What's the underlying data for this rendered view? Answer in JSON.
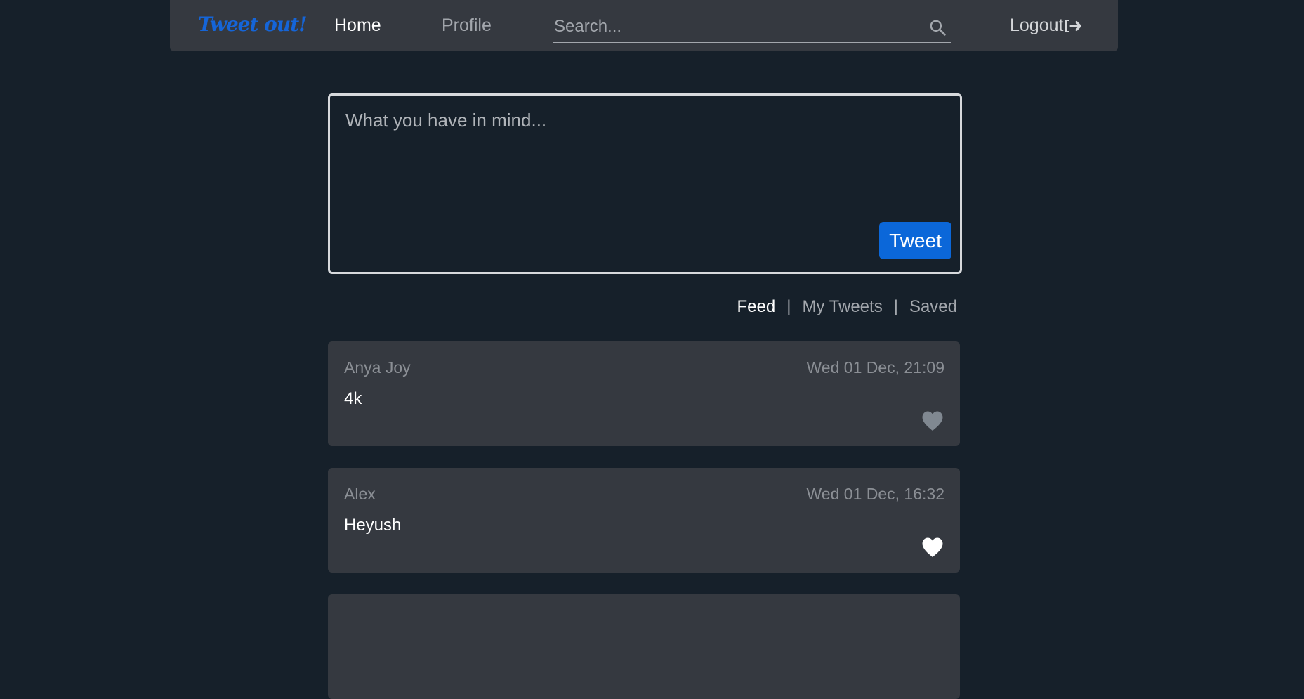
{
  "navbar": {
    "brand": "Tweet out!",
    "home_label": "Home",
    "profile_label": "Profile",
    "search_placeholder": "Search...",
    "logout_label": "Logout"
  },
  "composer": {
    "placeholder": "What you have in mind...",
    "tweet_button_label": "Tweet"
  },
  "tabs": [
    {
      "label": "Feed",
      "active": true
    },
    {
      "label": "My Tweets",
      "active": false
    },
    {
      "label": "Saved",
      "active": false
    }
  ],
  "tweets": [
    {
      "author": "Anya Joy",
      "date": "Wed 01 Dec, 21:09",
      "body": "4k",
      "liked": false
    },
    {
      "author": "Alex",
      "date": "Wed 01 Dec, 16:32",
      "body": "Heyush",
      "liked": true
    },
    {
      "author": "",
      "date": "",
      "body": "",
      "liked": false
    }
  ],
  "colors": {
    "background": "#16202a",
    "card": "#353940",
    "accent": "#0b67d9",
    "heart_liked": "#ffffff",
    "heart_unliked": "#808891"
  },
  "icons": {
    "search": "search-icon",
    "logout": "logout-arrow-icon",
    "like": "heart-icon"
  }
}
